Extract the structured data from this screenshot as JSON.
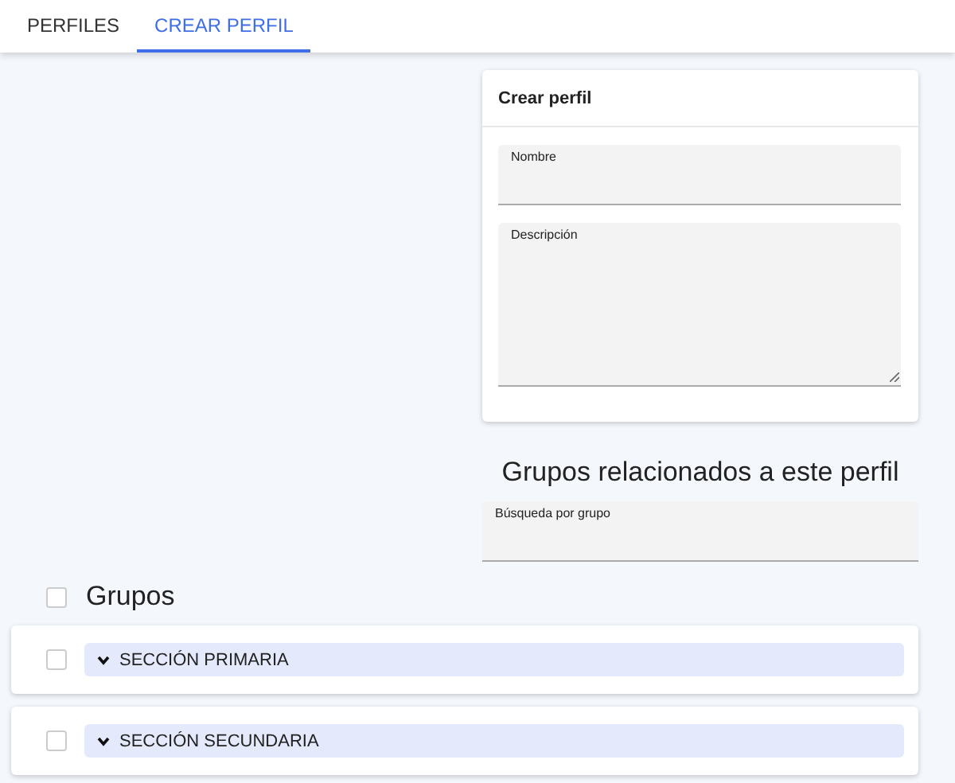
{
  "tabs": [
    {
      "label": "PERFILES",
      "selected": false
    },
    {
      "label": "CREAR PERFIL",
      "selected": true
    }
  ],
  "form": {
    "title": "Crear perfil",
    "fields": [
      {
        "kind": "input",
        "label": "Nombre"
      },
      {
        "kind": "textarea",
        "label": "Descripción"
      }
    ]
  },
  "related": {
    "heading": "Grupos relacionados a este perfil",
    "search": {
      "label": "Búsqueda por grupo"
    }
  },
  "groups": {
    "label": "Grupos",
    "checked": false,
    "sections": [
      {
        "label": "SECCIÓN PRIMARIA",
        "checked": false,
        "expanded": false
      },
      {
        "label": "SECCIÓN SECUNDARIA",
        "checked": false,
        "expanded": false
      }
    ]
  }
}
